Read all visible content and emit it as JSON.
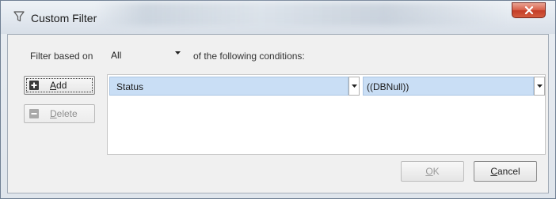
{
  "window": {
    "title": "Custom Filter",
    "accent": "#c33d27"
  },
  "filter": {
    "based_on_label": "Filter based on",
    "mode_value": "All",
    "conditions_label": "of the following conditions:"
  },
  "buttons": {
    "add": {
      "mnemonic": "A",
      "rest": "dd"
    },
    "delete": {
      "mnemonic": "D",
      "rest": "elete"
    },
    "ok": {
      "mnemonic": "O",
      "rest": "K"
    },
    "cancel": {
      "mnemonic": "C",
      "rest": "ancel"
    }
  },
  "conditions": [
    {
      "field": "Status",
      "value": "((DBNull))"
    }
  ],
  "icons": {
    "title": "filter-icon",
    "close": "close-icon",
    "add": "plus-icon",
    "delete": "minus-icon",
    "dropdown": "chevron-down-icon"
  }
}
